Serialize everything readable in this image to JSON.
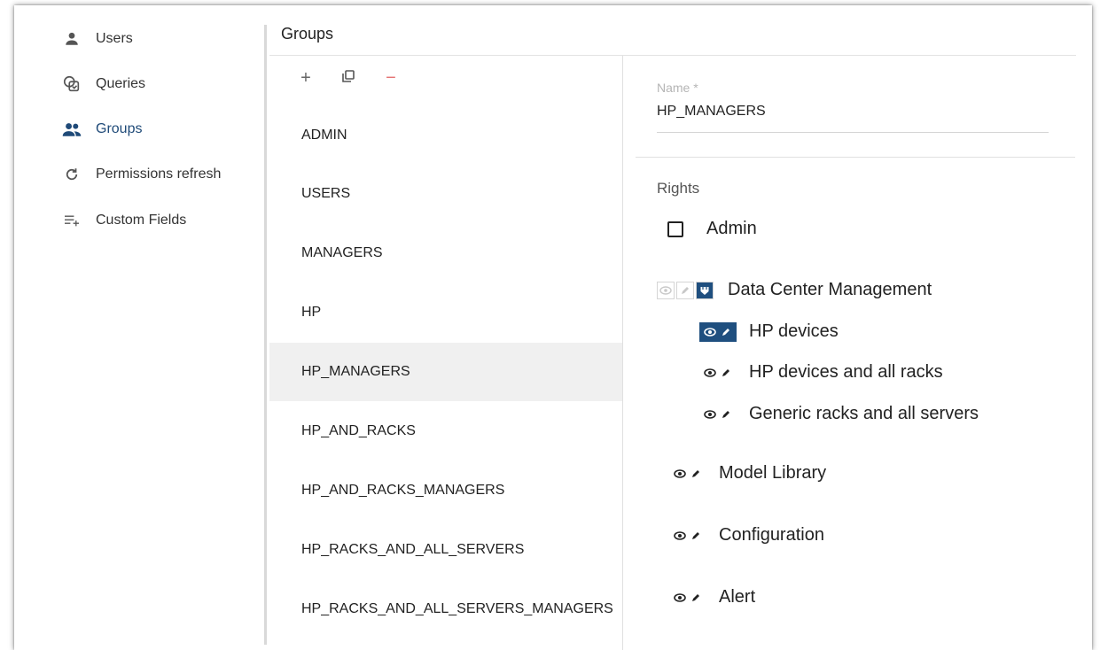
{
  "sidebar": {
    "items": [
      {
        "label": "Users",
        "icon": "person-icon",
        "active": false
      },
      {
        "label": "Queries",
        "icon": "queries-icon",
        "active": false
      },
      {
        "label": "Groups",
        "icon": "group-icon",
        "active": true
      },
      {
        "label": "Permissions refresh",
        "icon": "refresh-icon",
        "active": false
      },
      {
        "label": "Custom Fields",
        "icon": "playlist-add-icon",
        "active": false
      }
    ]
  },
  "groups": {
    "title": "Groups",
    "toolbar": {
      "add": "+",
      "remove": "−"
    },
    "list": [
      "ADMIN",
      "USERS",
      "MANAGERS",
      "HP",
      "HP_MANAGERS",
      "HP_AND_RACKS",
      "HP_AND_RACKS_MANAGERS",
      "HP_RACKS_AND_ALL_SERVERS",
      "HP_RACKS_AND_ALL_SERVERS_MANAGERS"
    ],
    "selected": "HP_MANAGERS"
  },
  "detail": {
    "name_label": "Name *",
    "name_value": "HP_MANAGERS",
    "rights_label": "Rights",
    "admin_label": "Admin",
    "dcm_label": "Data Center Management",
    "dcm_children": [
      {
        "label": "HP devices",
        "selected": true
      },
      {
        "label": "HP devices and all racks",
        "selected": false
      },
      {
        "label": "Generic racks and all servers",
        "selected": false
      }
    ],
    "other_rights": [
      "Model Library",
      "Configuration",
      "Alert"
    ]
  },
  "colors": {
    "accent": "#1f4f7f",
    "selected_row": "#f0f0f0",
    "remove": "#e57373"
  }
}
